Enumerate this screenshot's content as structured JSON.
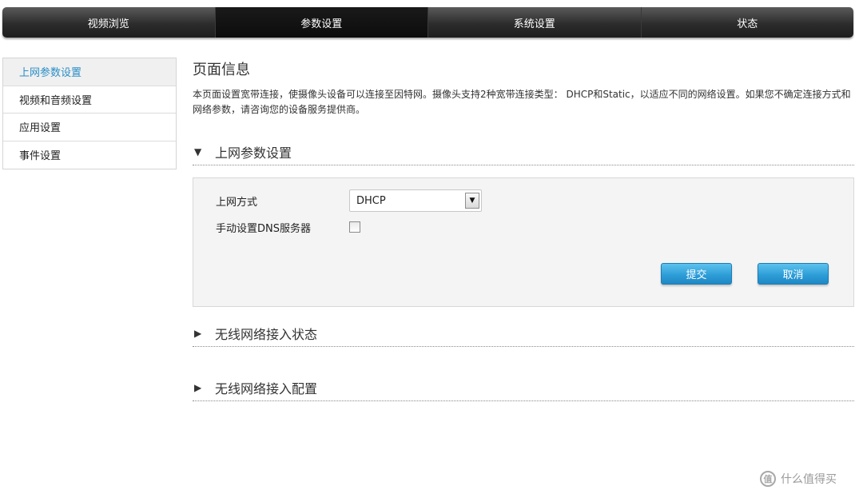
{
  "topnav": {
    "tabs": [
      {
        "label": "视频浏览",
        "active": false
      },
      {
        "label": "参数设置",
        "active": true
      },
      {
        "label": "系统设置",
        "active": false
      },
      {
        "label": "状态",
        "active": false
      }
    ]
  },
  "sidebar": {
    "items": [
      {
        "label": "上网参数设置",
        "active": true
      },
      {
        "label": "视频和音频设置",
        "active": false
      },
      {
        "label": "应用设置",
        "active": false
      },
      {
        "label": "事件设置",
        "active": false
      }
    ]
  },
  "main": {
    "title": "页面信息",
    "description": "本页面设置宽带连接，使摄像头设备可以连接至因特网。摄像头支持2种宽带连接类型： DHCP和Static，以适应不同的网络设置。如果您不确定连接方式和网络参数，请咨询您的设备服务提供商。",
    "sections": [
      {
        "label": "上网参数设置",
        "expanded": true,
        "arrow": "▼"
      },
      {
        "label": "无线网络接入状态",
        "expanded": false,
        "arrow": "▶"
      },
      {
        "label": "无线网络接入配置",
        "expanded": false,
        "arrow": "▶"
      }
    ],
    "form": {
      "connection_label": "上网方式",
      "connection_value": "DHCP",
      "dns_label": "手动设置DNS服务器",
      "dns_checked": false,
      "submit_label": "提交",
      "cancel_label": "取消"
    }
  },
  "watermark": {
    "icon_text": "值",
    "text": "什么值得买"
  },
  "colors": {
    "accent": "#2a8ec7",
    "button": "#2b9bd6",
    "nav_dark": "#2c2c2c"
  }
}
